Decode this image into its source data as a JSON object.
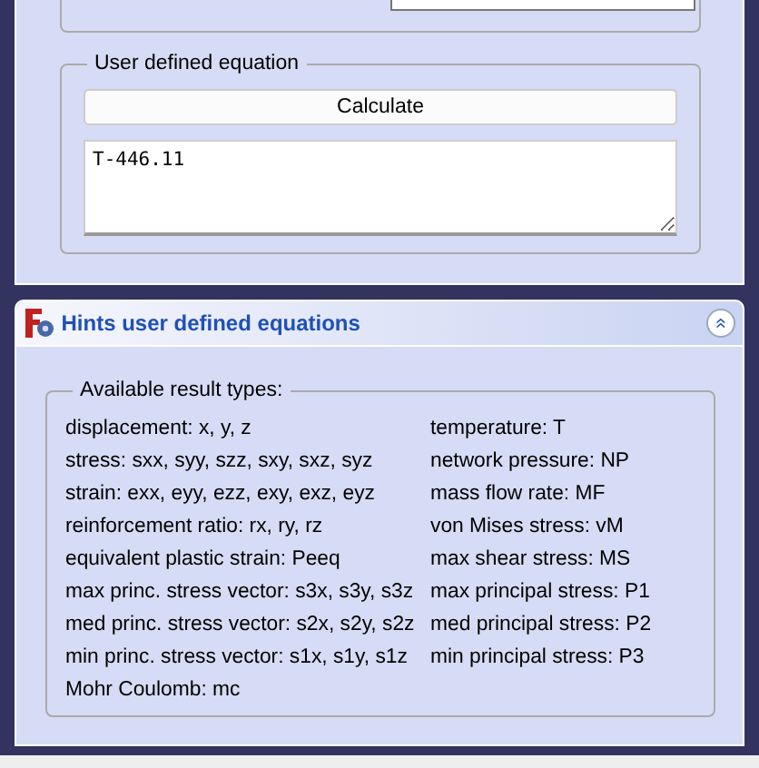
{
  "equation_panel": {
    "group_title": "User defined equation",
    "calculate_button": "Calculate",
    "equation": "T-446.11"
  },
  "hints_panel": {
    "title": "Hints user defined equations",
    "collapse_icon": "«",
    "expanded": true,
    "group_title": "Available result types:",
    "left_column": [
      "displacement: x, y, z",
      "stress: sxx, syy, szz, sxy, sxz, syz",
      "strain: exx, eyy, ezz, exy, exz, eyz",
      "reinforcement ratio: rx, ry, rz",
      "equivalent plastic strain: Peeq",
      "max princ. stress vector: s3x, s3y, s3z",
      "med princ. stress vector: s2x, s2y, s2z",
      "min princ. stress vector: s1x, s1y, s1z",
      "Mohr Coulomb: mc"
    ],
    "right_column": [
      "temperature: T",
      "network pressure: NP",
      "mass flow rate: MF",
      "von Mises stress: vM",
      "max shear stress: MS",
      "max principal stress: P1",
      "med principal stress: P2",
      "min principal stress: P3"
    ]
  }
}
